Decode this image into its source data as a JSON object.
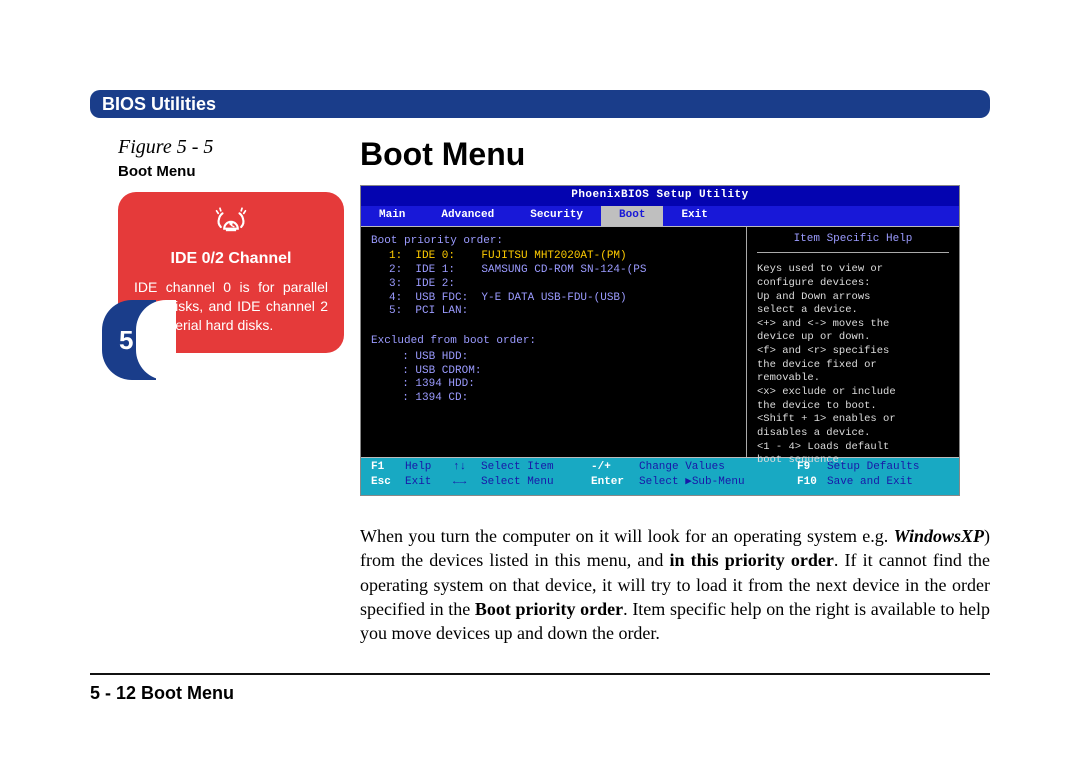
{
  "header": {
    "title": "BIOS Utilities"
  },
  "figure": {
    "label": "Figure 5 - 5",
    "subtitle": "Boot Menu"
  },
  "chapter": "5",
  "warning": {
    "icon": "alert-icon",
    "title": "IDE 0/2 Channel",
    "body": "IDE channel 0 is for parallel hard disks, and IDE channel 2 is for serial hard disks."
  },
  "page_title": "Boot Menu",
  "bios": {
    "title": "PhoenixBIOS Setup Utility",
    "tabs": [
      "Main",
      "Advanced",
      "Security",
      "Boot",
      "Exit"
    ],
    "active_tab": "Boot",
    "boot_header": "Boot priority order:",
    "boot_items": [
      {
        "idx": "1:",
        "dev": "IDE 0:",
        "desc": "FUJITSU MHT2020AT-(PM)",
        "hl": true
      },
      {
        "idx": "2:",
        "dev": "IDE 1:",
        "desc": "SAMSUNG CD-ROM SN-124-(PS",
        "hl": false
      },
      {
        "idx": "3:",
        "dev": "IDE 2:",
        "desc": "",
        "hl": false
      },
      {
        "idx": "4:",
        "dev": "USB FDC:",
        "desc": "Y-E DATA USB-FDU-(USB)",
        "hl": false
      },
      {
        "idx": "5:",
        "dev": "PCI LAN:",
        "desc": "",
        "hl": false
      }
    ],
    "excluded_header": "Excluded from boot order:",
    "excluded_items": [
      ": USB HDD:",
      ": USB CDROM:",
      ": 1394 HDD:",
      ": 1394 CD:"
    ],
    "help_title": "Item Specific Help",
    "help_body": "Keys used to view or\nconfigure devices:\nUp and Down arrows\nselect a device.\n<+> and <-> moves the\ndevice up or down.\n<f> and <r> specifies\nthe device fixed or\nremovable.\n<x> exclude or include\nthe device to boot.\n<Shift + 1> enables or\ndisables a device.\n<1 - 4> Loads default\nboot sequence.",
    "footer": {
      "r1": [
        "F1",
        "Help",
        "↑↓",
        "Select Item",
        "-/+",
        "Change Values",
        "F9",
        "Setup Defaults"
      ],
      "r2": [
        "Esc",
        "Exit",
        "←→",
        "Select Menu",
        "Enter",
        "Select ▶Sub-Menu",
        "F10",
        "Save and Exit"
      ]
    }
  },
  "body_para": {
    "p1a": "When you turn the computer on it will look for an operating system e.g. ",
    "p1b": "WindowsXP",
    "p1c": ") from the devices listed in this menu, and ",
    "p1d": "in this priority order",
    "p1e": ". If it cannot find the operating system on that device, it will try to load it from the next device in the order specified in the ",
    "p1f": "Boot priority order",
    "p1g": ". Item specific help on the right is available to help you move devices up and down the order."
  },
  "page_footer": "5 - 12  Boot Menu"
}
